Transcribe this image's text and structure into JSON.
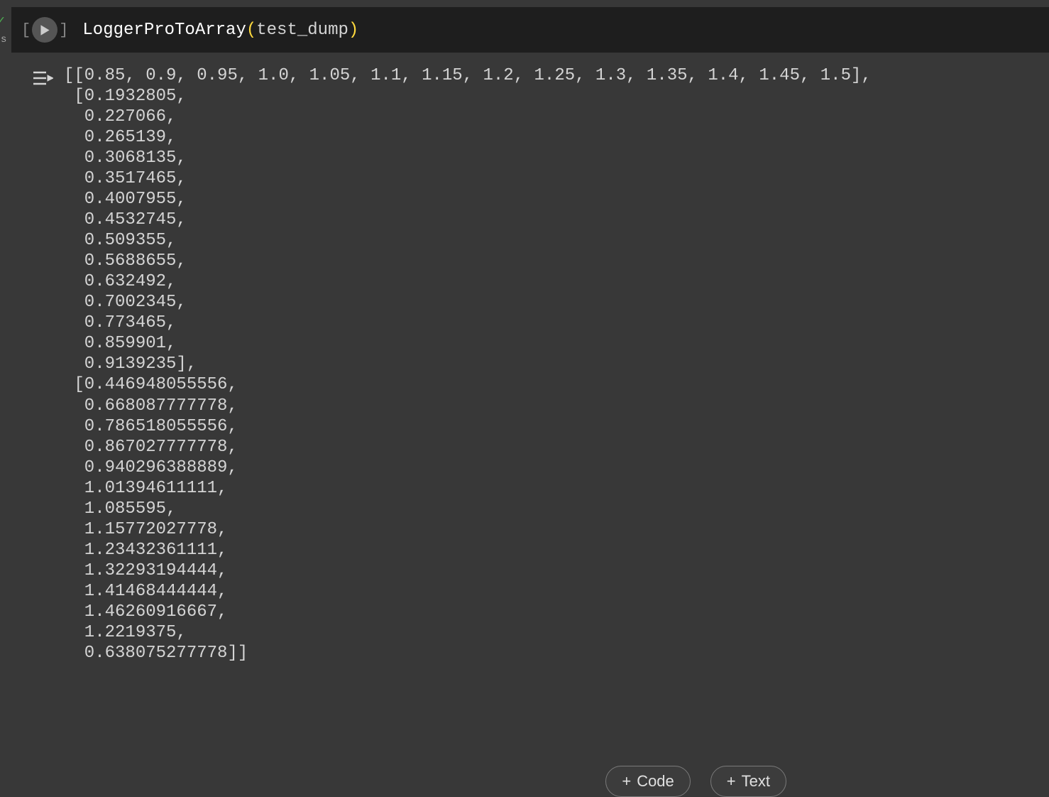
{
  "left_edge": {
    "check": "✓",
    "s_label": "s"
  },
  "code": {
    "function_name": "LoggerProToArray",
    "open_paren": "(",
    "argument": "test_dump",
    "close_paren": ")"
  },
  "output": {
    "array1": "[0.85, 0.9, 0.95, 1.0, 1.05, 1.1, 1.15, 1.2, 1.25, 1.3, 1.35, 1.4, 1.45, 1.5]",
    "array2": [
      "0.1932805",
      "0.227066",
      "0.265139",
      "0.3068135",
      "0.3517465",
      "0.4007955",
      "0.4532745",
      "0.509355",
      "0.5688655",
      "0.632492",
      "0.7002345",
      "0.773465",
      "0.859901",
      "0.9139235"
    ],
    "array3": [
      "0.446948055556",
      "0.668087777778",
      "0.786518055556",
      "0.867027777778",
      "0.940296388889",
      "1.01394611111",
      "1.085595",
      "1.15772027778",
      "1.23432361111",
      "1.32293194444",
      "1.41468444444",
      "1.46260916667",
      "1.2219375",
      "0.638075277778"
    ]
  },
  "buttons": {
    "code_label": "Code",
    "text_label": "Text"
  }
}
